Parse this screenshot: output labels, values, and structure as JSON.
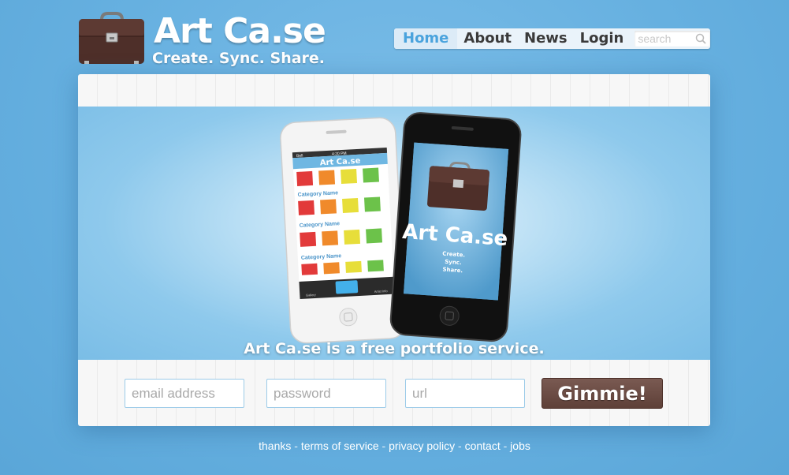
{
  "brand": {
    "title": "Art Ca.se",
    "tagline": "Create. Sync. Share."
  },
  "nav": {
    "items": [
      {
        "label": "Home",
        "active": true
      },
      {
        "label": "About",
        "active": false
      },
      {
        "label": "News",
        "active": false
      },
      {
        "label": "Login",
        "active": false
      }
    ],
    "search_placeholder": "search"
  },
  "hero": {
    "caption": "Art Ca.se is a free portfolio service.",
    "phone_white": {
      "status_carrier": "Bell",
      "status_time": "4:20 PM",
      "app_title": "Art Ca.se",
      "categories": [
        "Category Name",
        "Category Name",
        "Category Name"
      ],
      "tabs": [
        "Gallery",
        "",
        "Artist Info"
      ]
    },
    "phone_black": {
      "title": "Art Ca.se",
      "tagline_lines": [
        "Create.",
        "Sync.",
        "Share."
      ]
    }
  },
  "signup": {
    "email_placeholder": "email address",
    "password_placeholder": "password",
    "url_placeholder": "url",
    "submit_label": "Gimmie!"
  },
  "footer": {
    "links": [
      "thanks",
      "terms of service",
      "privacy policy",
      "contact",
      "jobs"
    ],
    "separator": " - "
  },
  "colors": {
    "background": "#66b0e0",
    "nav_active": "#4aa3dd",
    "button_brown": "#6b4a42",
    "field_border": "#9ccbe8"
  }
}
